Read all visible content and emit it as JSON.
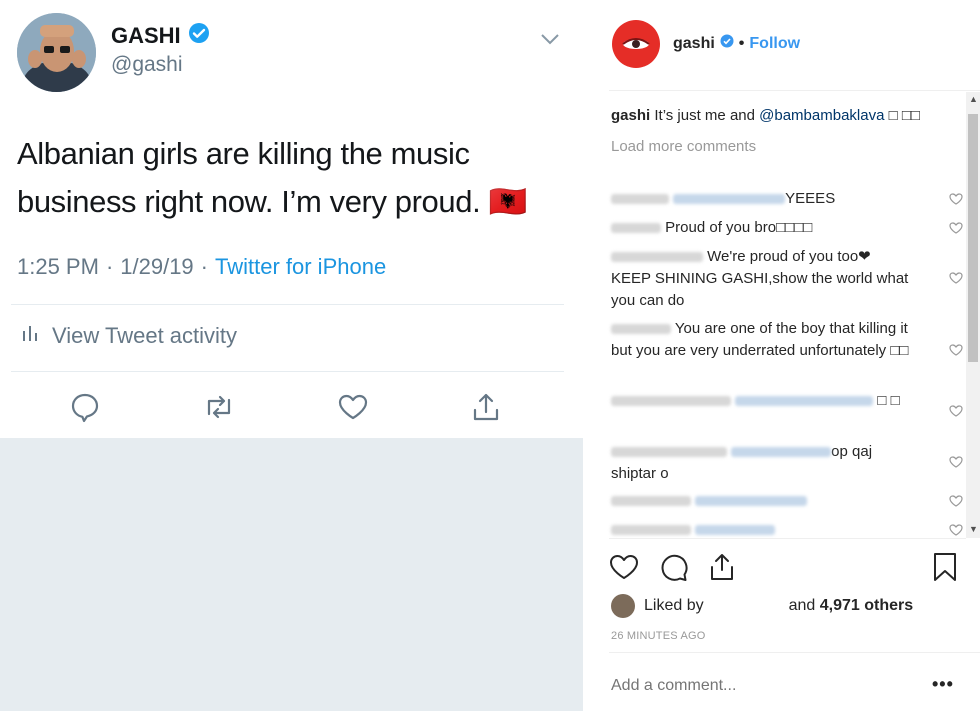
{
  "tweet": {
    "display_name": "GASHI",
    "handle": "@gashi",
    "text": "Albanian girls are killing the music business right now. I’m very proud. 🇦🇱",
    "time": "1:25 PM",
    "dot1": "·",
    "date": "1/29/19",
    "dot2": "·",
    "source": "Twitter for iPhone",
    "activity_label": "View Tweet activity",
    "icons": [
      "verified-badge-icon",
      "chevron-down-icon",
      "bar-chart-icon",
      "reply-icon",
      "retweet-icon",
      "like-icon",
      "share-icon"
    ],
    "colors": {
      "link": "#1b95e0",
      "muted": "#657786",
      "text": "#14171a",
      "verified": "#1da1f2"
    }
  },
  "instagram": {
    "username": "gashi",
    "separator": "•",
    "follow_label": "Follow",
    "caption_user": "gashi",
    "caption_text": "It’s just me and",
    "caption_mention": "@bambambaklava",
    "caption_tail": "□ □□",
    "load_more": "Load more comments",
    "comments": [
      {
        "text": "YEEES"
      },
      {
        "text": "Proud of you bro□□□□"
      },
      {
        "text": "We're proud of you too❤ KEEP SHINING GASHI,show the world what you can do"
      },
      {
        "text": "You are one of the boy that killing it but you are very underrated unfortunately □□"
      },
      {
        "text": "□ □"
      },
      {
        "text": "op qaj shiptar o"
      },
      {
        "text": ""
      },
      {
        "text": ""
      }
    ],
    "liked_by": "Liked by",
    "liked_and": "and",
    "likes_count": "4,971 others",
    "time_ago": "26 MINUTES AGO",
    "add_comment_placeholder": "Add a comment...",
    "more_label": "•••",
    "icons": [
      "heart-icon",
      "comment-icon",
      "share-icon",
      "bookmark-icon"
    ],
    "colors": {
      "follow": "#3897f0",
      "muted": "#999999",
      "text": "#262626",
      "avatar": "#e52d27"
    }
  }
}
